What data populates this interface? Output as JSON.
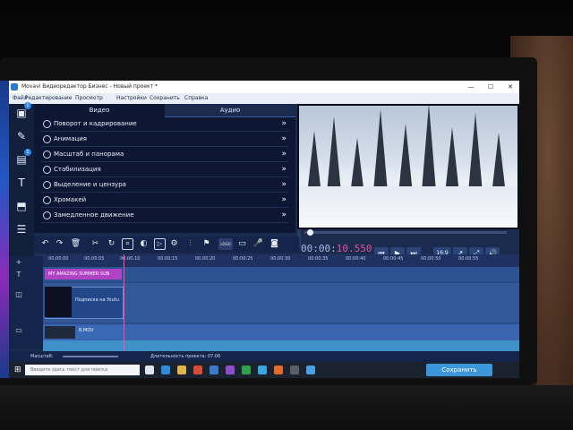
{
  "window": {
    "title": "Movavi Видеоредактор Бизнес - Новый проект *",
    "controls": [
      "—",
      "☐",
      "✕"
    ]
  },
  "menu": [
    "Файл",
    "Редактирование",
    "Просмотр",
    "Настройки",
    "Сохранить",
    "Справка"
  ],
  "left_tools": [
    "import-icon",
    "magic-wand-icon",
    "filters-icon",
    "titles-icon",
    "stickers-icon",
    "more-icon"
  ],
  "panel": {
    "tab_video": "Видео",
    "tab_audio": "Аудио",
    "effects": [
      "Поворот и кадрирование",
      "Анимация",
      "Масштаб и панорама",
      "Стабилизация",
      "Выделение и цензура",
      "Хромакей",
      "Замедленное движение"
    ],
    "chevron": "»"
  },
  "toolbar": {
    "logo_label": "LOGO"
  },
  "player": {
    "timecode_prefix": "00:00:",
    "timecode_highlight": "10.550",
    "ratio": "16:9"
  },
  "ruler": {
    "ticks": [
      "00:00:00",
      "00:00:05",
      "00:00:10",
      "00:00:15",
      "00:00:20",
      "00:00:25",
      "00:00:30",
      "00:00:35",
      "00:00:40",
      "00:00:45",
      "00:00:50",
      "00:00:55"
    ]
  },
  "timeline": {
    "title_clip": "MY AMAZING SUMMER SUB",
    "subscribe_clip": "Подписка на Youtu",
    "video_clip": "B.MOV"
  },
  "status": {
    "zoom_label": "Масштаб:",
    "duration_label": "Длительность проекта: 07:06"
  },
  "taskbar": {
    "search_placeholder": "Введите здесь текст для поиска",
    "save_button": "Сохранить"
  },
  "colors": {
    "accent": "#3c96d9",
    "playhead": "#ff4fa0",
    "title_clip": "#b043c4"
  }
}
